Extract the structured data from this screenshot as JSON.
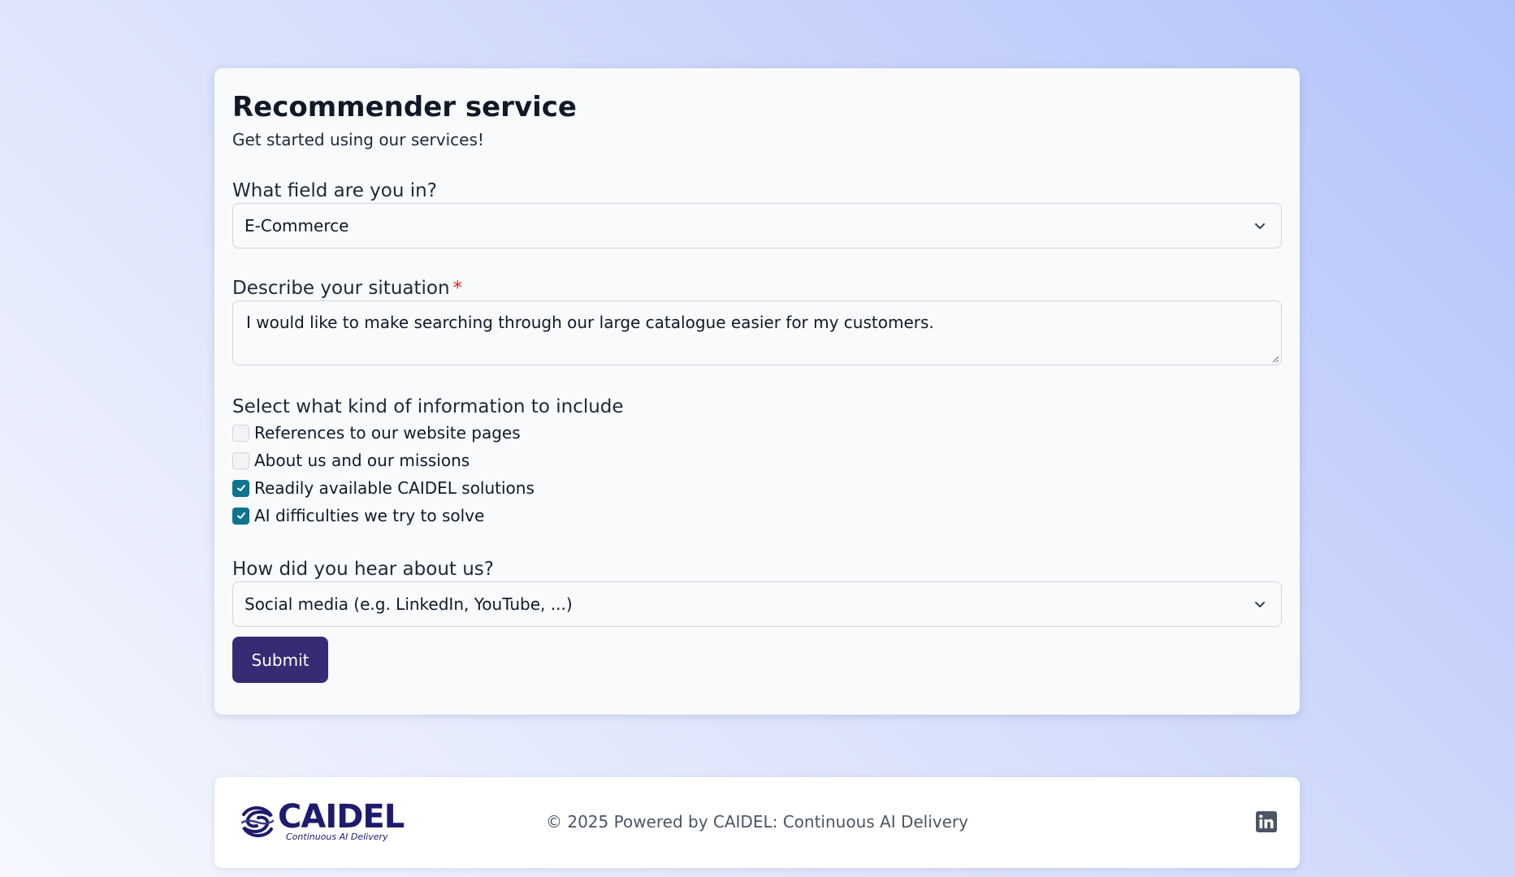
{
  "form": {
    "title": "Recommender service",
    "subtitle": "Get started using our services!",
    "field": {
      "label": "What field are you in?",
      "selected": "E-Commerce"
    },
    "situation": {
      "label": "Describe your situation",
      "required_marker": "*",
      "value": "I would like to make searching through our large catalogue easier for my customers."
    },
    "info": {
      "label": "Select what kind of information to include",
      "options": [
        {
          "label": "References to our website pages",
          "checked": false
        },
        {
          "label": "About us and our missions",
          "checked": false
        },
        {
          "label": "Readily available CAIDEL solutions",
          "checked": true
        },
        {
          "label": "AI difficulties we try to solve",
          "checked": true
        }
      ]
    },
    "source": {
      "label": "How did you hear about us?",
      "selected": "Social media (e.g. LinkedIn, YouTube, ...)"
    },
    "submit_label": "Submit"
  },
  "footer": {
    "logo_word": "CAIDEL",
    "logo_tagline": "Continuous AI Delivery",
    "copyright": "© 2025 Powered by CAIDEL: Continuous AI Delivery",
    "social_icon": "linkedin-icon"
  },
  "colors": {
    "accent": "#362c74",
    "checkbox_checked": "#0e7490",
    "required": "#dc2626"
  }
}
